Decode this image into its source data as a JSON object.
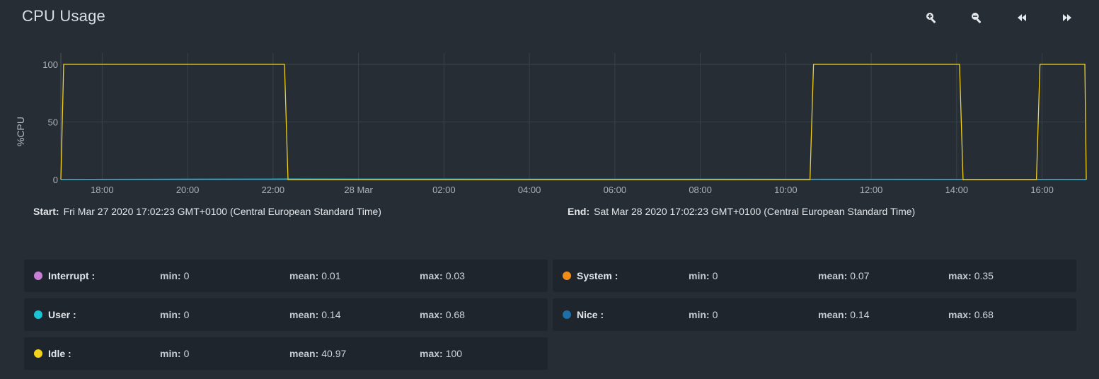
{
  "header": {
    "title": "CPU Usage",
    "toolbar": [
      {
        "name": "zoom-in",
        "icon": "zoom-in-icon"
      },
      {
        "name": "zoom-out",
        "icon": "zoom-out-icon"
      },
      {
        "name": "rewind",
        "icon": "rewind-icon"
      },
      {
        "name": "fast-forward",
        "icon": "fast-forward-icon"
      }
    ]
  },
  "range": {
    "start_label": "Start:",
    "start_value": "Fri Mar 27 2020 17:02:23 GMT+0100 (Central European Standard Time)",
    "end_label": "End:",
    "end_value": "Sat Mar 28 2020 17:02:23 GMT+0100 (Central European Standard Time)"
  },
  "stats": [
    {
      "name": "Interrupt :",
      "color": "#c77fd6",
      "min": "0",
      "mean": "0.01",
      "max": "0.03"
    },
    {
      "name": "System :",
      "color": "#f08c17",
      "min": "0",
      "mean": "0.07",
      "max": "0.35"
    },
    {
      "name": "User :",
      "color": "#19c4d6",
      "min": "0",
      "mean": "0.14",
      "max": "0.68"
    },
    {
      "name": "Nice :",
      "color": "#1e6fa8",
      "min": "0",
      "mean": "0.14",
      "max": "0.68"
    },
    {
      "name": "Idle :",
      "color": "#f2d21b",
      "min": "0",
      "mean": "40.97",
      "max": "100"
    }
  ],
  "stat_labels": {
    "min": "min:",
    "mean": "mean:",
    "max": "max:"
  },
  "chart_data": {
    "type": "line",
    "ylabel": "%CPU",
    "ylim": [
      0,
      100
    ],
    "yticks": [
      0,
      50,
      100
    ],
    "xlim": [
      "2020-03-27 17:02",
      "2020-03-28 17:02"
    ],
    "xticks": [
      {
        "t": "2020-03-27 18:00",
        "label": "18:00"
      },
      {
        "t": "2020-03-27 20:00",
        "label": "20:00"
      },
      {
        "t": "2020-03-27 22:00",
        "label": "22:00"
      },
      {
        "t": "2020-03-28 00:00",
        "label": "28 Mar"
      },
      {
        "t": "2020-03-28 02:00",
        "label": "02:00"
      },
      {
        "t": "2020-03-28 04:00",
        "label": "04:00"
      },
      {
        "t": "2020-03-28 06:00",
        "label": "06:00"
      },
      {
        "t": "2020-03-28 08:00",
        "label": "08:00"
      },
      {
        "t": "2020-03-28 10:00",
        "label": "10:00"
      },
      {
        "t": "2020-03-28 12:00",
        "label": "12:00"
      },
      {
        "t": "2020-03-28 14:00",
        "label": "14:00"
      },
      {
        "t": "2020-03-28 16:00",
        "label": "16:00"
      }
    ],
    "grid": true,
    "series": [
      {
        "name": "Idle",
        "color": "#f2d21b",
        "points": [
          [
            "2020-03-27 17:02",
            0
          ],
          [
            "2020-03-27 17:06",
            100
          ],
          [
            "2020-03-27 22:16",
            100
          ],
          [
            "2020-03-27 22:21",
            0
          ],
          [
            "2020-03-28 10:34",
            0
          ],
          [
            "2020-03-28 10:39",
            100
          ],
          [
            "2020-03-28 14:04",
            100
          ],
          [
            "2020-03-28 14:09",
            0
          ],
          [
            "2020-03-28 15:52",
            0
          ],
          [
            "2020-03-28 15:57",
            100
          ],
          [
            "2020-03-28 17:00",
            100
          ],
          [
            "2020-03-28 17:02",
            0
          ]
        ]
      },
      {
        "name": "User",
        "color": "#19c4d6",
        "points": [
          [
            "2020-03-27 17:02",
            0.2
          ],
          [
            "2020-03-27 22:20",
            0.5
          ],
          [
            "2020-03-28 10:40",
            0.3
          ],
          [
            "2020-03-28 17:02",
            0.2
          ]
        ]
      },
      {
        "name": "Nice",
        "color": "#1e6fa8",
        "points": [
          [
            "2020-03-27 17:02",
            0.1
          ],
          [
            "2020-03-28 17:02",
            0.1
          ]
        ]
      }
    ]
  }
}
